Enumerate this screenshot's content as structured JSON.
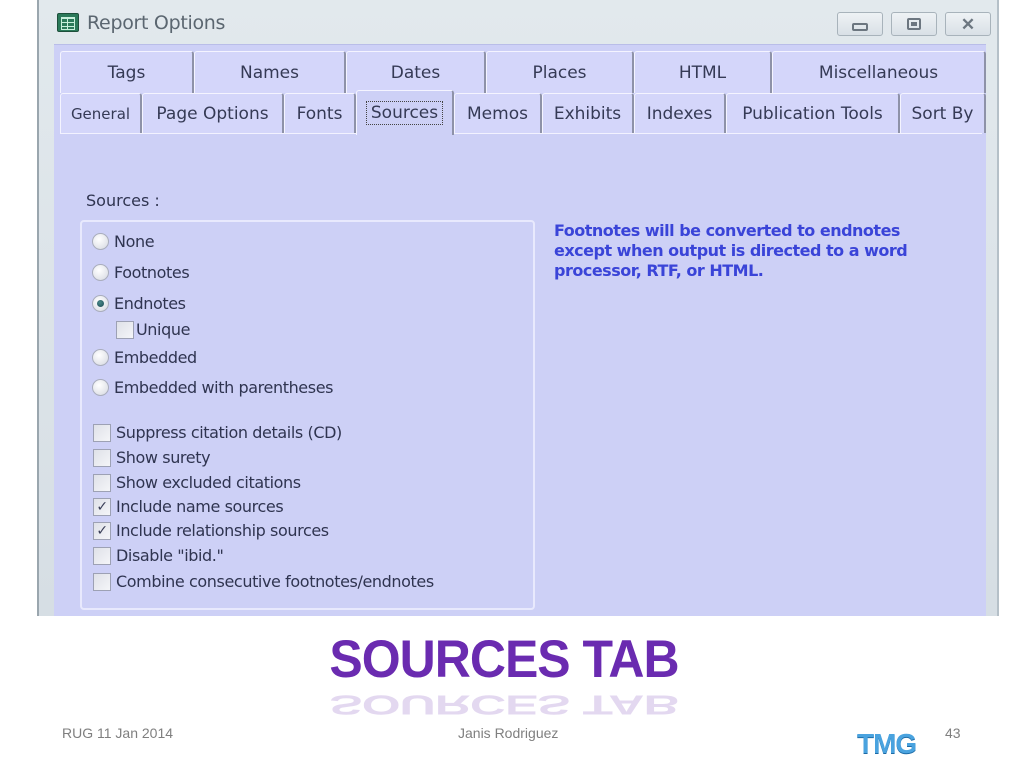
{
  "window": {
    "title": "Report Options",
    "icon": "report-grid-icon",
    "controls": {
      "minimize": "minimize-icon",
      "maximize": "maximize-icon",
      "close": "close-icon"
    }
  },
  "tabs": {
    "row1": [
      "Tags",
      "Names",
      "Dates",
      "Places",
      "HTML",
      "Miscellaneous"
    ],
    "row2": [
      "General",
      "Page Options",
      "Fonts",
      "Sources",
      "Memos",
      "Exhibits",
      "Indexes",
      "Publication Tools",
      "Sort By"
    ],
    "active": "Sources"
  },
  "sources": {
    "group_label": "Sources :",
    "radios": [
      {
        "label": "None",
        "selected": false
      },
      {
        "label": "Footnotes",
        "selected": false
      },
      {
        "label": "Endnotes",
        "selected": true
      },
      {
        "label": "Embedded",
        "selected": false
      },
      {
        "label": "Embedded with parentheses",
        "selected": false
      }
    ],
    "unique": {
      "label": "Unique",
      "checked": false
    },
    "checkboxes": [
      {
        "label": "Suppress citation details (CD)",
        "checked": false
      },
      {
        "label": "Show surety",
        "checked": false
      },
      {
        "label": "Show excluded citations",
        "checked": false
      },
      {
        "label": "Include name sources",
        "checked": true
      },
      {
        "label": "Include relationship sources",
        "checked": true
      },
      {
        "label": "Disable \"ibid.\"",
        "checked": false
      },
      {
        "label": "Combine consecutive footnotes/endnotes",
        "checked": false
      }
    ],
    "note": "Footnotes will be converted to endnotes except when output is directed to a word processor, RTF, or HTML."
  },
  "slide": {
    "title": "SOURCES TAB",
    "footer_left": "RUG 11 Jan 2014",
    "footer_center": "Janis Rodriguez",
    "logo": "TMG",
    "page_number": "43"
  },
  "colors": {
    "client_bg": "#cdd0f6",
    "note_text": "#3a44d8",
    "title_purple": "#6a2bb0",
    "logo_blue": "#4aa3df"
  }
}
